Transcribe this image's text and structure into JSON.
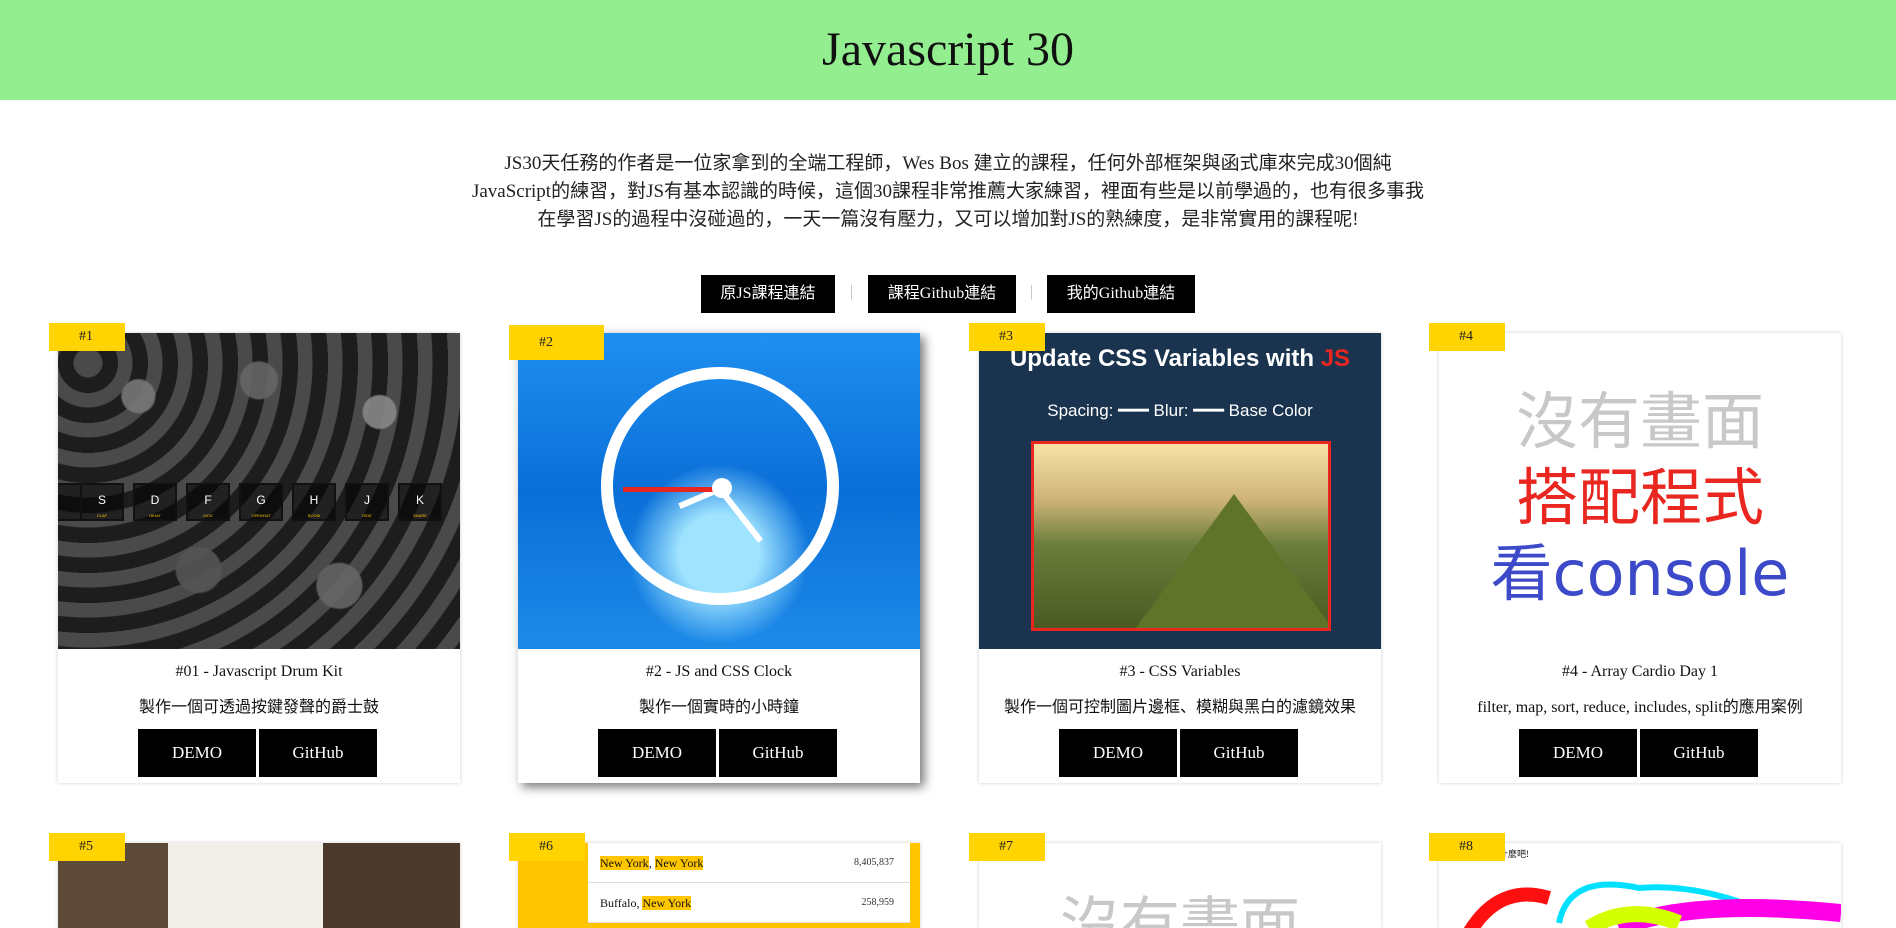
{
  "header": {
    "title": "Javascript 30"
  },
  "intro": {
    "text": "JS30天任務的作者是一位家拿到的全端工程師，Wes Bos 建立的課程，任何外部框架與函式庫來完成30個純JavaScript的練習，對JS有基本認識的時候，這個30課程非常推薦大家練習，裡面有些是以前學過的，也有很多事我在學習JS的過程中沒碰過的，一天一篇沒有壓力，又可以增加對JS的熟練度，是非常實用的課程呢!"
  },
  "links": {
    "course": "原JS課程連結",
    "course_github": "課程Github連結",
    "my_github": "我的Github連結",
    "separator": "|"
  },
  "cards": [
    {
      "badge": "#1",
      "title": "#01 - Javascript Drum Kit",
      "desc": "製作一個可透過按鍵發聲的爵士鼓",
      "demo": "DEMO",
      "github": "GitHub",
      "keys": [
        "S",
        "D",
        "F",
        "G",
        "H",
        "J",
        "K"
      ]
    },
    {
      "badge": "#2",
      "title": "#2 - JS and CSS Clock",
      "desc": "製作一個實時的小時鐘",
      "demo": "DEMO",
      "github": "GitHub"
    },
    {
      "badge": "#3",
      "title": "#3 - CSS Variables",
      "desc": "製作一個可控制圖片邊框、模糊與黑白的濾鏡效果",
      "demo": "DEMO",
      "github": "GitHub",
      "thumb_heading": "Update CSS Variables with ",
      "thumb_heading_js": "JS",
      "thumb_controls": "Spacing:  ━━━  Blur:  ━━━  Base Color"
    },
    {
      "badge": "#4",
      "title": "#4 - Array Cardio Day 1",
      "desc": "filter, map, sort, reduce, includes, split的應用案例",
      "demo": "DEMO",
      "github": "GitHub",
      "no_image": "沒有畫面",
      "pair_code": "搭配程式",
      "see_console": "看console"
    },
    {
      "badge": "#5"
    },
    {
      "badge": "#6",
      "rows": [
        {
          "city": "New York",
          "state": "New York",
          "pop": "8,405,837"
        },
        {
          "city": "Buffalo",
          "state": "New York",
          "pop": "258,959"
        }
      ]
    },
    {
      "badge": "#7",
      "no_image": "沒有畫面"
    },
    {
      "badge": "#8",
      "thumb_text": "什麼吧!"
    }
  ],
  "colors": {
    "header_bg": "#93ee8f",
    "badge": "#ffd400",
    "button": "#000000",
    "accent_red": "#e9261f",
    "console_blue": "#3c4ac9"
  }
}
